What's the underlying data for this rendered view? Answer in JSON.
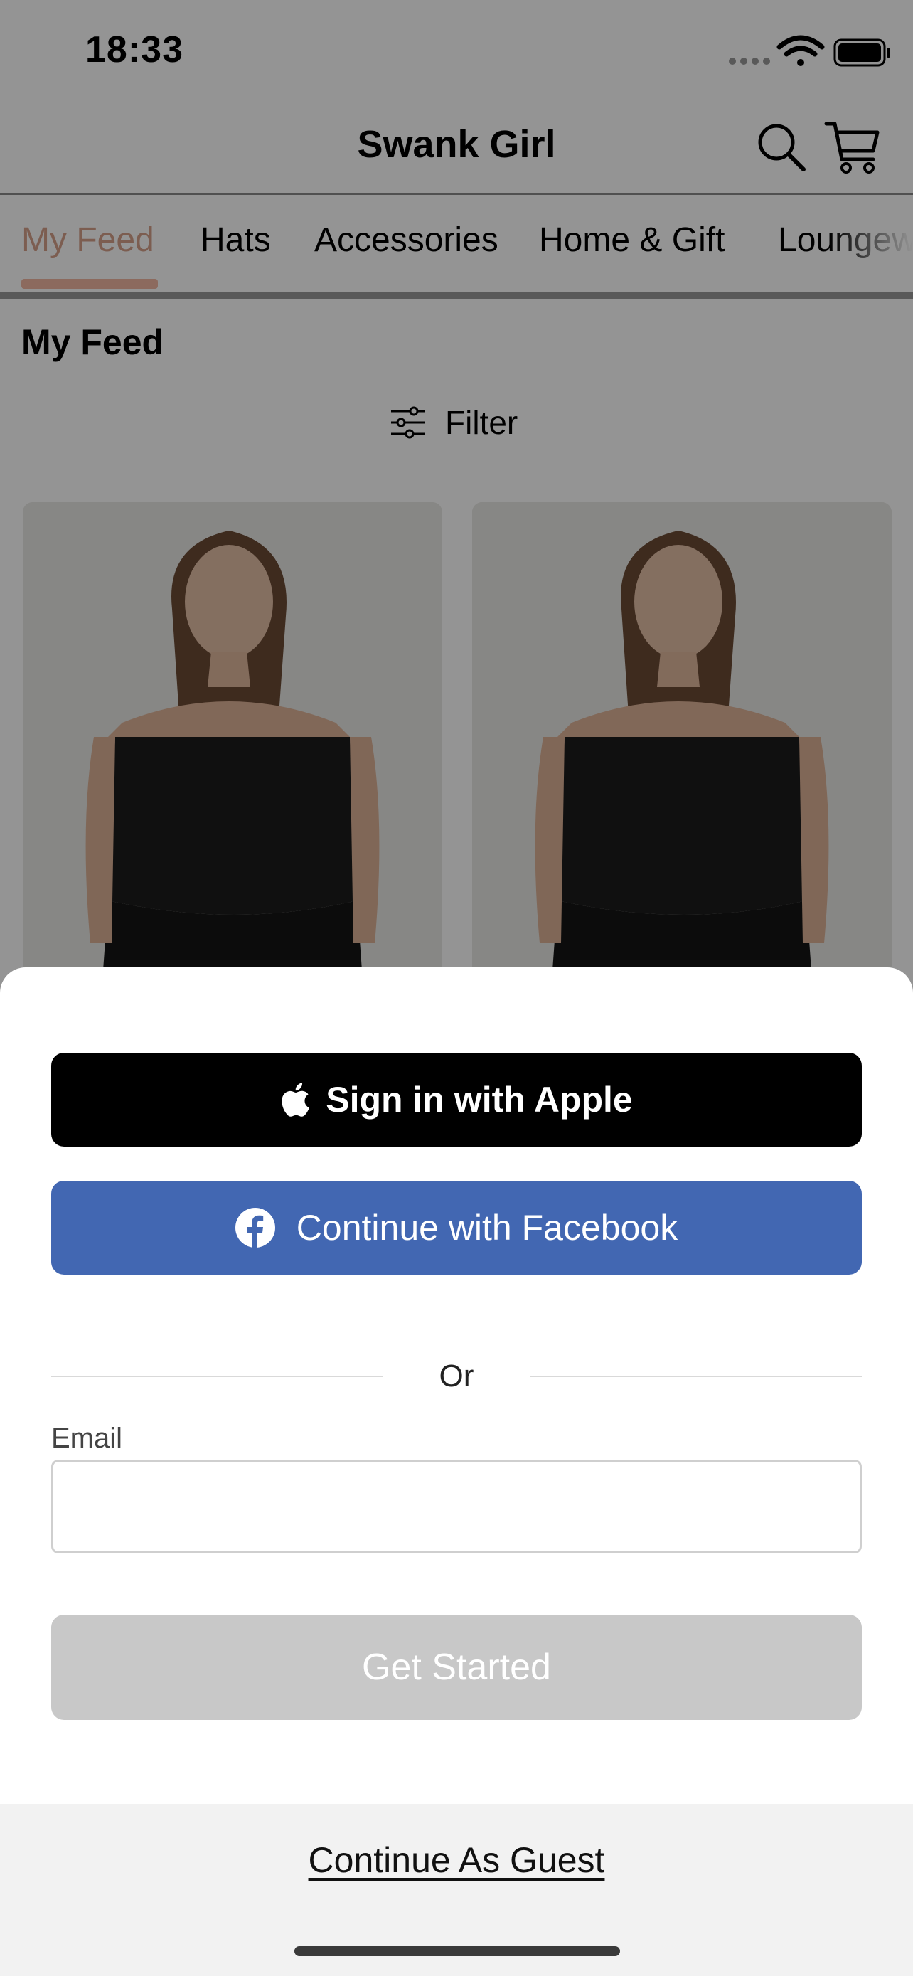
{
  "status_bar": {
    "time": "18:33"
  },
  "header": {
    "title": "Swank Girl",
    "search_icon": "search-icon",
    "cart_icon": "cart-icon"
  },
  "tabs": [
    {
      "label": "My Feed",
      "active": true
    },
    {
      "label": "Hats",
      "active": false
    },
    {
      "label": "Accessories",
      "active": false
    },
    {
      "label": "Home & Gift",
      "active": false
    },
    {
      "label": "Loungewear",
      "active": false
    }
  ],
  "feed": {
    "title": "My Feed",
    "filter_label": "Filter"
  },
  "sheet": {
    "apple_button": "Sign in with Apple",
    "facebook_button": "Continue with Facebook",
    "divider_text": "Or",
    "email_label": "Email",
    "email_value": "",
    "get_started_button": "Get Started",
    "guest_link": "Continue As Guest"
  },
  "colors": {
    "tab_active": "#d6a08a",
    "tab_indicator": "#f1b7a3",
    "apple_bg": "#000000",
    "facebook_bg": "#4267b2",
    "get_started_disabled": "#c8c8c8"
  }
}
